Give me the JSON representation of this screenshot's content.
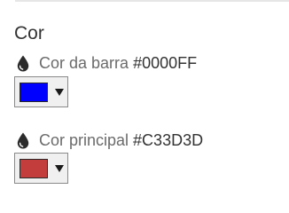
{
  "section": {
    "title": "Cor"
  },
  "fields": [
    {
      "label": "Cor da barra",
      "hex": "#0000FF",
      "color": "#0000FF",
      "icon": "water-drop-icon"
    },
    {
      "label": "Cor principal",
      "hex": "#C33D3D",
      "color": "#C33D3D",
      "icon": "water-drop-icon"
    }
  ]
}
